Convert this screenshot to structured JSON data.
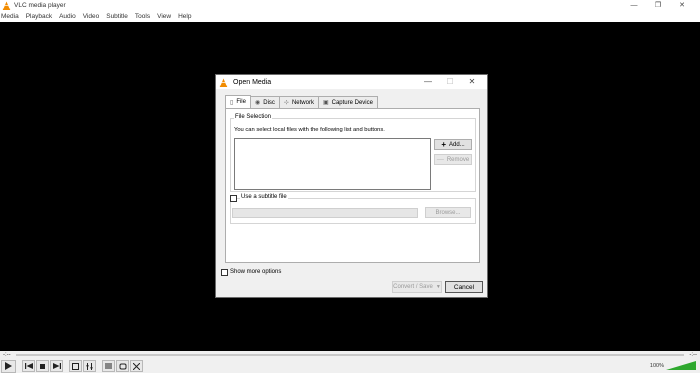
{
  "window": {
    "title": "VLC media player",
    "controls": {
      "minimize": "—",
      "restore": "❐",
      "close": "✕"
    }
  },
  "menu": [
    "Media",
    "Playback",
    "Audio",
    "Video",
    "Subtitle",
    "Tools",
    "View",
    "Help"
  ],
  "seek": {
    "time_left": "-:--",
    "time_right": "-:--"
  },
  "volume": {
    "percent": "100%"
  },
  "dialog": {
    "title": "Open Media",
    "controls": {
      "minimize": "—",
      "maximize": "☐",
      "close": "✕"
    },
    "tabs": [
      {
        "label": "File",
        "icon": "file-icon",
        "active": true
      },
      {
        "label": "Disc",
        "icon": "disc-icon",
        "active": false
      },
      {
        "label": "Network",
        "icon": "network-icon",
        "active": false
      },
      {
        "label": "Capture Device",
        "icon": "capture-device-icon",
        "active": false
      }
    ],
    "file_selection": {
      "legend": "File Selection",
      "description": "You can select local files with the following list and buttons.",
      "add_label": "Add...",
      "remove_label": "Remove"
    },
    "subtitle": {
      "checkbox_label": "Use a subtitle file",
      "path_value": "",
      "browse_label": "Browse..."
    },
    "show_more_label": "Show more options",
    "convert_label": "Convert / Save",
    "cancel_label": "Cancel"
  },
  "colors": {
    "video_bg": "#000000",
    "volume_green": "#2ea82e",
    "vlc_orange": "#f28c00"
  }
}
